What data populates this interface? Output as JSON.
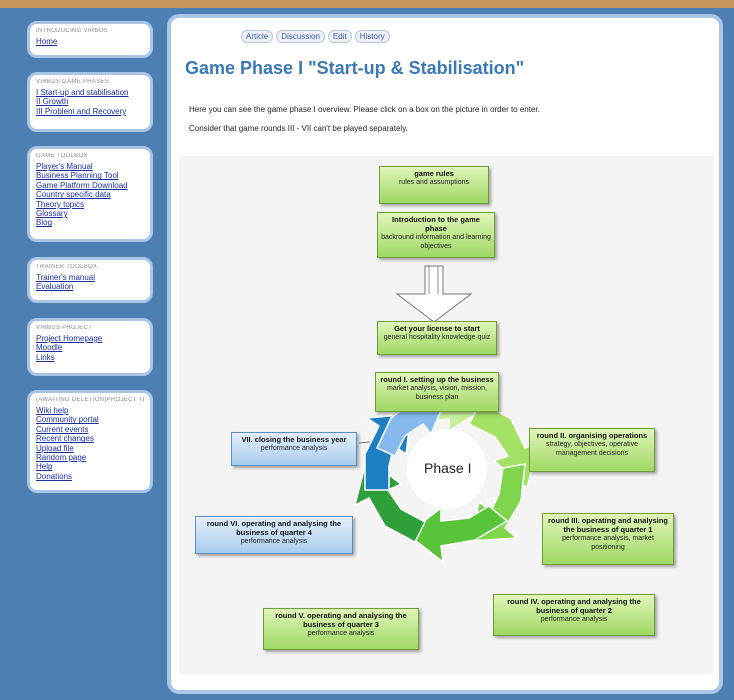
{
  "sidebar": {
    "intro": {
      "header": "INTRODUCING VIRBUS",
      "links": [
        "Home"
      ]
    },
    "phases": {
      "header": "VIRBUS GAME PHASES",
      "links": [
        "I Start-up and stabilisation",
        "II Growth",
        "III Problem and Recovery"
      ]
    },
    "toolbox": {
      "header": "GAME TOOLBOX",
      "links": [
        "Player's Manual",
        "Business Planning Tool",
        "Game Platform Download",
        "Country specific data",
        "Theory topics",
        "Glossary",
        "Blog"
      ]
    },
    "trainer": {
      "header": "TRAINER TOOLBOX",
      "links": [
        "Trainer's manual",
        "Evaluation"
      ]
    },
    "project": {
      "header": "VIRBUS PROJECT",
      "links": [
        "Project Homepage",
        "Moodle",
        "Links"
      ]
    },
    "team": {
      "header": "(awaiting deletion)PROJECT TEAM",
      "links": [
        "Wiki help",
        "Community portal",
        "Current events",
        "Recent changes",
        "Upload file",
        "Random page",
        "Help",
        "Donations"
      ]
    }
  },
  "tabs": [
    "Article",
    "Discussion",
    "Edit",
    "History"
  ],
  "page": {
    "title": "Game Phase I \"Start-up & Stabilisation\"",
    "intro": "Here you can see the game phase I overview. Please click on a box on the picture in order to enter.",
    "note": "Consider that game rounds III - VII can't be played separately."
  },
  "diagram": {
    "center_label": "Phase I",
    "boxes": [
      {
        "title": "game rules",
        "desc": "rules and assumptions"
      },
      {
        "title": "Introduction to the game phase",
        "desc": "backround information and learning objectives"
      },
      {
        "title": "Get your license to start",
        "desc": "general hospitality knowledge quiz"
      },
      {
        "title": "round I. setting up the business",
        "desc": "market analysis, vision, mission, business plan"
      },
      {
        "title": "round II. organising operations",
        "desc": "strategy, objectives, operative management decisions"
      },
      {
        "title": "round III. operating and analysing the business of quarter 1",
        "desc": "performance analysis, market positioning"
      },
      {
        "title": "round IV. operating and analysing the business of quarter 2",
        "desc": "performance analysis"
      },
      {
        "title": "round V. operating and analysing the business of quarter 3",
        "desc": "performance analysis"
      },
      {
        "title": "round VI. operating and analysing the business of quarter 4",
        "desc": "performance analysis"
      },
      {
        "title": "VII. closing the business year",
        "desc": "performance analysis"
      }
    ],
    "colors": {
      "green": "#9fd864",
      "blue": "#a8cdee",
      "title": "#3a79b8"
    }
  }
}
